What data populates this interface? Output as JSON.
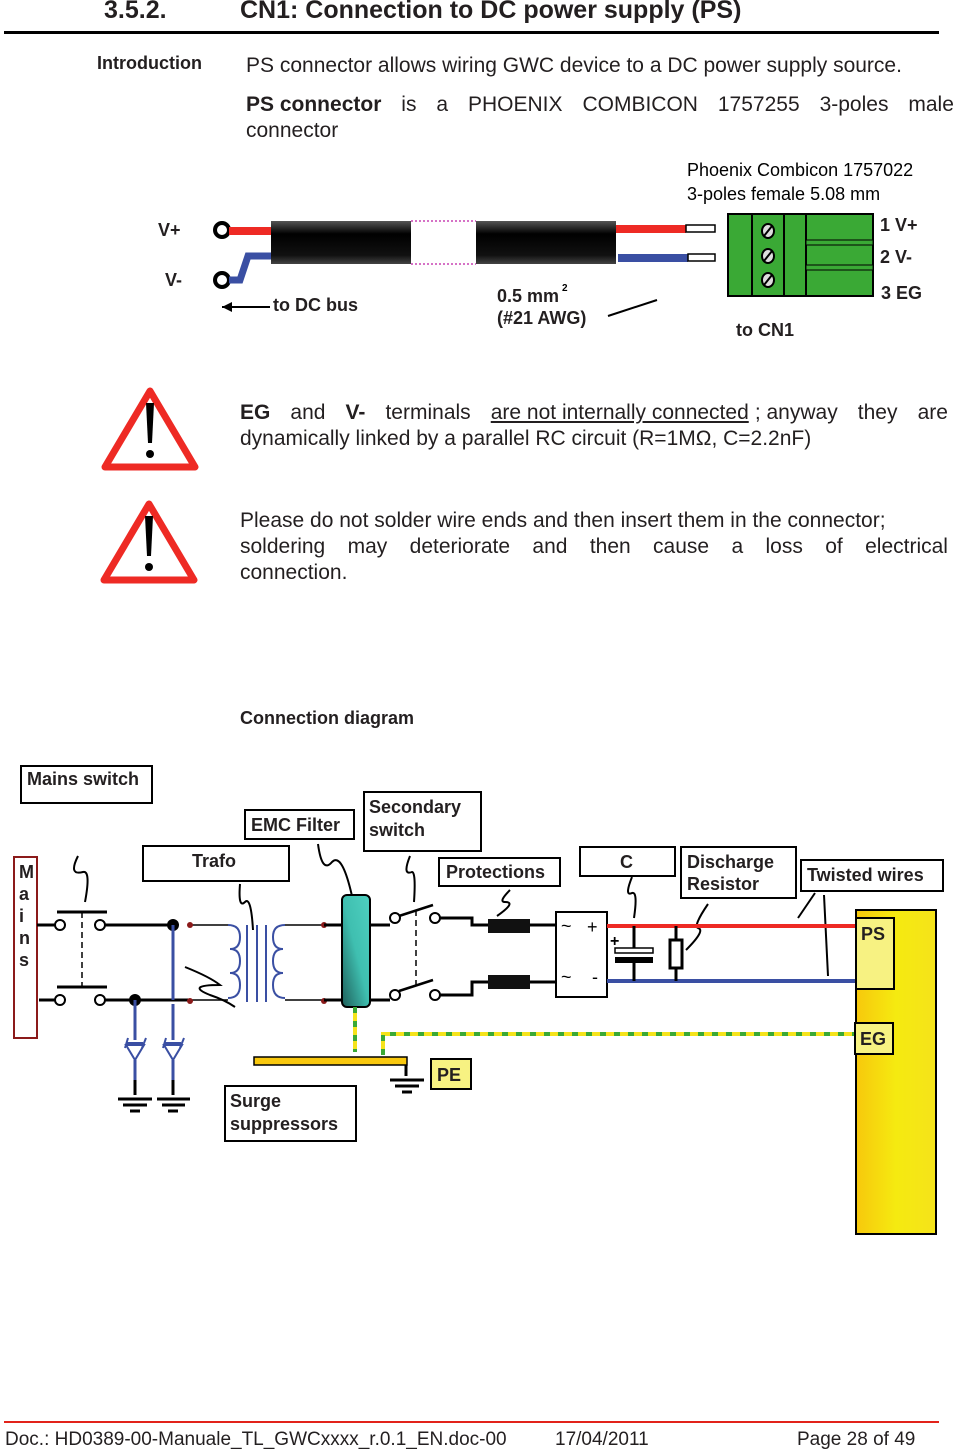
{
  "heading": {
    "number": "3.5.2.",
    "title": "CN1: Connection to DC power supply (PS)"
  },
  "intro": {
    "side_label": "Introduction",
    "p1": "PS connector allows wiring GWC device to a DC power supply source.",
    "p2_bold": "PS connector",
    "p2_rest_words": [
      "is",
      "a",
      "PHOENIX",
      "COMBICON",
      "1757255",
      "3-poles",
      "male"
    ],
    "p2_line2": "connector"
  },
  "cable_figure": {
    "connector_line1": "Phoenix Combicon 1757022",
    "connector_line2": "3-poles female 5.08 mm",
    "v_plus": "V+",
    "v_minus": "V-",
    "to_dc_bus": "to DC bus",
    "wire_size": "0.5 mm",
    "wire_size_sup": "2",
    "awg": "(#21 AWG)",
    "pin1": "1 V+",
    "pin2": "2 V-",
    "pin3": "3 EG",
    "to_cn1": "to CN1"
  },
  "warnings": [
    {
      "icon": "warning-triangle-icon",
      "line1": {
        "b1": "EG",
        "w1": "and",
        "b2": "V-",
        "w2": "terminals",
        "u": "are not internally connected",
        "rest": [
          "; anyway",
          "they",
          "are"
        ]
      },
      "line2": "dynamically linked by a parallel RC circuit (R=1MΩ, C=2.2nF)"
    },
    {
      "icon": "warning-triangle-icon",
      "line1": "Please do not solder wire ends and then insert them in the connector;",
      "line2_words": [
        "soldering",
        "may",
        "deteriorate",
        "and",
        "then",
        "cause",
        "a",
        "loss",
        "of",
        "electrical"
      ],
      "line3": "connection."
    }
  ],
  "connection_diagram": {
    "title": "Connection diagram",
    "labels": {
      "mains_switch": "Mains switch",
      "mains": "Mains",
      "emc_filter": "EMC Filter",
      "secondary_switch_1": "Secondary",
      "secondary_switch_2": "switch",
      "trafo": "Trafo",
      "protections": "Protections",
      "c": "C",
      "discharge_1": "Discharge",
      "discharge_2": "Resistor",
      "twisted_wires": "Twisted wires",
      "ps": "PS",
      "eg": "EG",
      "pe": "PE",
      "surge_1": "Surge",
      "surge_2": "suppressors",
      "bridge_ac1": "~",
      "bridge_ac2": "~",
      "bridge_plus": "+",
      "bridge_minus": "-",
      "cap_plus": "+"
    },
    "colors": {
      "positive": "#ee2a24",
      "negative": "#3a4fa3",
      "device": "#f5e31a",
      "emc": "#3fbfb0",
      "pe_bar": "#f9c80e",
      "connector": "#3aa935"
    }
  },
  "footer": {
    "doc": "Doc.: HD0389-00-Manuale_TL_GWCxxxx_r.0.1_EN.doc-00",
    "date": "17/04/2011",
    "page": "Page 28 of 49"
  }
}
